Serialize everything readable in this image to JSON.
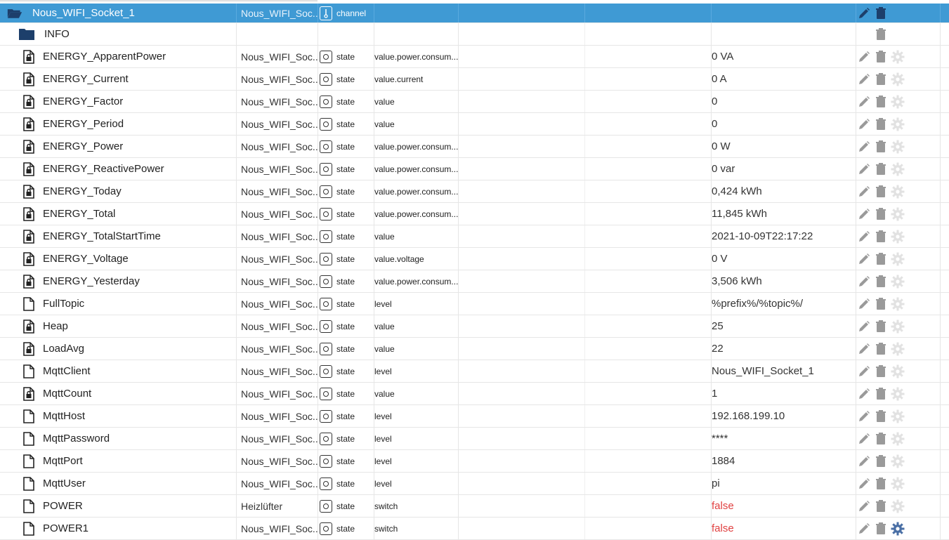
{
  "channel": {
    "name": "Nous_WIFI_Socket_1",
    "room": "Nous_WIFI_Soc...",
    "type": "channel",
    "type_icon": "channel-icon"
  },
  "folder": {
    "name": "INFO",
    "icon": "folder-icon"
  },
  "colors": {
    "header": "#3f9ad4",
    "false_value": "#e04040",
    "action_icon": "#9a9a9a",
    "gear_active": "#4a6fa5"
  },
  "rows": [
    {
      "name": "ENERGY_ApparentPower",
      "room": "Nous_WIFI_Soc...",
      "type": "state",
      "role": "value.power.consum...",
      "value": "0 VA",
      "icon": "lock-file-icon"
    },
    {
      "name": "ENERGY_Current",
      "room": "Nous_WIFI_Soc...",
      "type": "state",
      "role": "value.current",
      "value": "0 A",
      "icon": "lock-file-icon"
    },
    {
      "name": "ENERGY_Factor",
      "room": "Nous_WIFI_Soc...",
      "type": "state",
      "role": "value",
      "value": "0",
      "icon": "lock-file-icon"
    },
    {
      "name": "ENERGY_Period",
      "room": "Nous_WIFI_Soc...",
      "type": "state",
      "role": "value",
      "value": "0",
      "icon": "lock-file-icon"
    },
    {
      "name": "ENERGY_Power",
      "room": "Nous_WIFI_Soc...",
      "type": "state",
      "role": "value.power.consum...",
      "value": "0 W",
      "icon": "lock-file-icon"
    },
    {
      "name": "ENERGY_ReactivePower",
      "room": "Nous_WIFI_Soc...",
      "type": "state",
      "role": "value.power.consum...",
      "value": "0 var",
      "icon": "lock-file-icon"
    },
    {
      "name": "ENERGY_Today",
      "room": "Nous_WIFI_Soc...",
      "type": "state",
      "role": "value.power.consum...",
      "value": "0,424 kWh",
      "icon": "lock-file-icon"
    },
    {
      "name": "ENERGY_Total",
      "room": "Nous_WIFI_Soc...",
      "type": "state",
      "role": "value.power.consum...",
      "value": "11,845 kWh",
      "icon": "lock-file-icon"
    },
    {
      "name": "ENERGY_TotalStartTime",
      "room": "Nous_WIFI_Soc...",
      "type": "state",
      "role": "value",
      "value": "2021-10-09T22:17:22",
      "icon": "lock-file-icon"
    },
    {
      "name": "ENERGY_Voltage",
      "room": "Nous_WIFI_Soc...",
      "type": "state",
      "role": "value.voltage",
      "value": "0 V",
      "icon": "lock-file-icon"
    },
    {
      "name": "ENERGY_Yesterday",
      "room": "Nous_WIFI_Soc...",
      "type": "state",
      "role": "value.power.consum...",
      "value": "3,506 kWh",
      "icon": "lock-file-icon"
    },
    {
      "name": "FullTopic",
      "room": "Nous_WIFI_Soc...",
      "type": "state",
      "role": "level",
      "value": "%prefix%/%topic%/",
      "icon": "file-icon"
    },
    {
      "name": "Heap",
      "room": "Nous_WIFI_Soc...",
      "type": "state",
      "role": "value",
      "value": "25",
      "icon": "lock-file-icon"
    },
    {
      "name": "LoadAvg",
      "room": "Nous_WIFI_Soc...",
      "type": "state",
      "role": "value",
      "value": "22",
      "icon": "lock-file-icon"
    },
    {
      "name": "MqttClient",
      "room": "Nous_WIFI_Soc...",
      "type": "state",
      "role": "level",
      "value": "Nous_WIFI_Socket_1",
      "icon": "file-icon"
    },
    {
      "name": "MqttCount",
      "room": "Nous_WIFI_Soc...",
      "type": "state",
      "role": "value",
      "value": "1",
      "icon": "lock-file-icon"
    },
    {
      "name": "MqttHost",
      "room": "Nous_WIFI_Soc...",
      "type": "state",
      "role": "level",
      "value": "192.168.199.10",
      "icon": "file-icon"
    },
    {
      "name": "MqttPassword",
      "room": "Nous_WIFI_Soc...",
      "type": "state",
      "role": "level",
      "value": "****",
      "icon": "file-icon"
    },
    {
      "name": "MqttPort",
      "room": "Nous_WIFI_Soc...",
      "type": "state",
      "role": "level",
      "value": "1884",
      "icon": "file-icon"
    },
    {
      "name": "MqttUser",
      "room": "Nous_WIFI_Soc...",
      "type": "state",
      "role": "level",
      "value": "pi",
      "icon": "file-icon"
    },
    {
      "name": "POWER",
      "room": "Heizlüfter",
      "type": "state",
      "role": "switch",
      "value": "false",
      "icon": "file-icon"
    },
    {
      "name": "POWER1",
      "room": "Nous_WIFI_Soc...",
      "type": "state",
      "role": "switch",
      "value": "false",
      "icon": "file-icon",
      "gear_active": true
    }
  ]
}
